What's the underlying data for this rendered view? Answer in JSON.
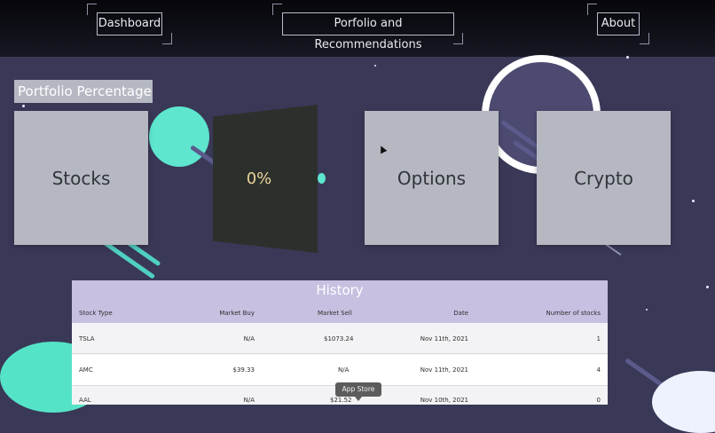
{
  "nav": {
    "dashboard": "Dashboard",
    "portfolio": "Porfolio and Recommendations",
    "about": "About"
  },
  "portfolio": {
    "title": "Portfolio Percentage",
    "cards": {
      "stocks": "Stocks",
      "percent": "0%",
      "options": "Options",
      "crypto": "Crypto"
    }
  },
  "history": {
    "title": "History",
    "columns": [
      "Stock Type",
      "Market Buy",
      "Market Sell",
      "Date",
      "Number of stocks"
    ],
    "rows": [
      [
        "TSLA",
        "N/A",
        "$1073.24",
        "Nov 11th, 2021",
        "1"
      ],
      [
        "AMC",
        "$39.33",
        "N/A",
        "Nov 11th, 2021",
        "4"
      ],
      [
        "AAL",
        "N/A",
        "$21.52",
        "Nov 10th, 2021",
        "0"
      ]
    ]
  },
  "tooltip": "App Store",
  "colors": {
    "background": "#3a3857",
    "card": "#b5b8c1",
    "teal": "#5ee6cf",
    "history_header": "#c7c0e1"
  }
}
